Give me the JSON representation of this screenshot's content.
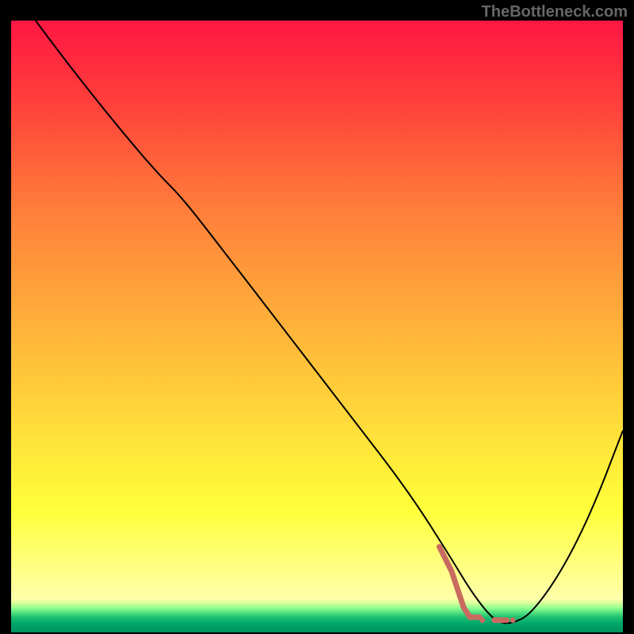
{
  "watermark": "TheBottleneck.com",
  "chart_data": {
    "type": "line",
    "title": "",
    "xlabel": "",
    "ylabel": "",
    "xlim": [
      0,
      100
    ],
    "ylim": [
      0,
      100
    ],
    "background_gradient": {
      "stops": [
        {
          "offset": 0.0,
          "color": "#ff1744"
        },
        {
          "offset": 0.12,
          "color": "#ff3b3b"
        },
        {
          "offset": 0.3,
          "color": "#ff7b3a"
        },
        {
          "offset": 0.5,
          "color": "#ffb23a"
        },
        {
          "offset": 0.68,
          "color": "#ffe13a"
        },
        {
          "offset": 0.8,
          "color": "#ffff3a"
        },
        {
          "offset": 0.9,
          "color": "#ffff88"
        },
        {
          "offset": 0.945,
          "color": "#ffffaa"
        },
        {
          "offset": 0.952,
          "color": "#d8ff9a"
        },
        {
          "offset": 0.96,
          "color": "#90ff90"
        },
        {
          "offset": 0.968,
          "color": "#50e080"
        },
        {
          "offset": 0.975,
          "color": "#20c070"
        },
        {
          "offset": 0.985,
          "color": "#00a86b"
        },
        {
          "offset": 1.0,
          "color": "#009060"
        }
      ]
    },
    "series": [
      {
        "name": "main-curve",
        "color": "#000000",
        "width": 2,
        "x": [
          4,
          10,
          18,
          24,
          28,
          35,
          45,
          55,
          65,
          72,
          75,
          78,
          80,
          82,
          85,
          90,
          95,
          100
        ],
        "y": [
          100,
          92,
          82,
          75,
          71,
          62,
          49,
          36,
          23,
          12,
          7,
          3,
          1.5,
          1.5,
          3,
          10,
          20,
          33
        ]
      },
      {
        "name": "highlight-segment",
        "color": "#c96a60",
        "width": 7,
        "style": "dotted-irregular",
        "x": [
          70,
          72,
          73,
          74,
          75,
          77,
          79,
          81,
          82
        ],
        "y": [
          14,
          10,
          7,
          4,
          2.5,
          2,
          2,
          2,
          2
        ]
      }
    ]
  }
}
